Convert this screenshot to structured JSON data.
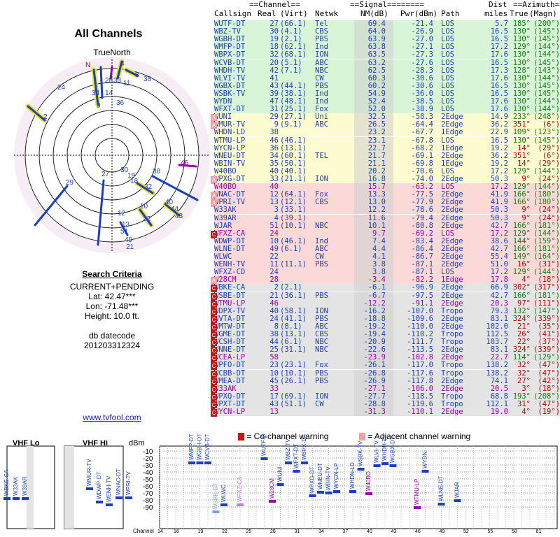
{
  "title": "All Channels",
  "north_label": "TrueNorth",
  "criteria": {
    "heading": "Search Criteria",
    "lines": [
      "CURRENT+PENDING",
      "Lat: 42.47***",
      "Lon: -71.48***",
      "Height: 10.0 ft.",
      "",
      "db datecode",
      "201203312324"
    ]
  },
  "site_link": "www.tvfool.com",
  "table_header": {
    "group_channel": "==Channel==",
    "group_signal": "==Signal========",
    "group_azimuth": "==Azimuth==",
    "cols": [
      "Callsign",
      "Real",
      "(Virt)",
      "Netwk",
      "NM(dB)",
      "Pwr(dBm)",
      "Path",
      "Dist",
      "True",
      "(Magn)"
    ],
    "dist_unit": "miles"
  },
  "colors": {
    "green": "#d8f5d8",
    "yellow": "#fdfbd0",
    "red": "#fbd9d9",
    "gray": "#e4e4e4",
    "nm_band": "#cfcfcf",
    "blue_text": "#1a3fc0",
    "purple_text": "#9b00b0",
    "red_text": "#c00000",
    "green_text": "#108010",
    "marker": "#c01818"
  },
  "stations": [
    [
      "WUTF-DT",
      "27",
      "(66.1)",
      "Tel",
      "69.4",
      "-21.4",
      "LOS",
      "5.7",
      "185°",
      "(200°)",
      "green",
      ""
    ],
    [
      "WBZ-TV",
      "30",
      "(4.1)",
      "CBS",
      "64.0",
      "-26.9",
      "LOS",
      "16.5",
      "130°",
      "(145°)",
      "green",
      ""
    ],
    [
      "WGBH-DT",
      "19",
      "(2.1)",
      "PBS",
      "63.9",
      "-27.0",
      "LOS",
      "16.5",
      "130°",
      "(145°)",
      "green",
      ""
    ],
    [
      "WMFP-DT",
      "18",
      "(62.1)",
      "Ind",
      "63.8",
      "-27.1",
      "LOS",
      "17.2",
      "129°",
      "(144°)",
      "green",
      ""
    ],
    [
      "WBPX-DT",
      "32",
      "(68.1)",
      "ION",
      "63.5",
      "-27.3",
      "LOS",
      "17.6",
      "130°",
      "(144°)",
      "green",
      ""
    ],
    [
      "WCVB-DT",
      "20",
      "(5.1)",
      "ABC",
      "63.2",
      "-27.6",
      "LOS",
      "16.5",
      "130°",
      "(145°)",
      "green",
      ""
    ],
    [
      "WHDH-TV",
      "42",
      "(7.1)",
      "NBC",
      "62.5",
      "-28.3",
      "LOS",
      "17.3",
      "128°",
      "(143°)",
      "green",
      ""
    ],
    [
      "WLVI-TV",
      "41",
      "",
      "CW",
      "60.3",
      "-30.6",
      "LOS",
      "17.6",
      "130°",
      "(144°)",
      "green",
      ""
    ],
    [
      "WGBX-DT",
      "43",
      "(44.1)",
      "PBS",
      "60.2",
      "-30.6",
      "LOS",
      "16.5",
      "130°",
      "(145°)",
      "green",
      ""
    ],
    [
      "WSBK-TV",
      "39",
      "(38.1)",
      "Ind",
      "54.9",
      "-36.0",
      "LOS",
      "16.5",
      "130°",
      "(145°)",
      "green",
      ""
    ],
    [
      "WYDN",
      "47",
      "(48.1)",
      "Ind",
      "52.4",
      "-38.5",
      "LOS",
      "17.6",
      "130°",
      "(144°)",
      "green",
      ""
    ],
    [
      "WFXT-DT",
      "31",
      "(25.1)",
      "Fox",
      "52.0",
      "-38.9",
      "LOS",
      "17.6",
      "130°",
      "(144°)",
      "green",
      ""
    ],
    [
      "WUNI",
      "29",
      "(27.1)",
      "Uni",
      "32.5",
      "-58.3",
      "2Edge",
      "14.9",
      "233°",
      "(248°)",
      "yellow",
      "A"
    ],
    [
      "WMUR-TV",
      "9",
      "(9.1)",
      "ABC",
      "26.5",
      "-64.4",
      "2Edge",
      "36.2",
      "351°",
      "(6°)",
      "yellow",
      "A"
    ],
    [
      "WHDN-LD",
      "38",
      "",
      "",
      "23.2",
      "-67.7",
      "1Edge",
      "22.9",
      "109°",
      "(123°)",
      "yellow",
      ""
    ],
    [
      "WTMU-LP",
      "46",
      "(46.1)",
      "",
      "23.1",
      "-67.8",
      "LOS",
      "16.5",
      "130°",
      "(145°)",
      "yellow",
      ""
    ],
    [
      "WYCN-LP",
      "36",
      "(13.1)",
      "",
      "22.7",
      "-68.2",
      "1Edge",
      "19.2",
      "14°",
      "(29°)",
      "yellow",
      ""
    ],
    [
      "WNEU-DT",
      "34",
      "(60.1)",
      "TEL",
      "21.7",
      "-69.1",
      "2Edge",
      "36.2",
      "351°",
      "(6°)",
      "yellow",
      ""
    ],
    [
      "WBIN-TV",
      "35",
      "(50.1)",
      "",
      "21.1",
      "-69.8",
      "1Edge",
      "19.2",
      "14°",
      "(29°)",
      "yellow",
      ""
    ],
    [
      "W40BO",
      "40",
      "(40.1)",
      "",
      "20.2",
      "-70.6",
      "LOS",
      "17.2",
      "129°",
      "(144°)",
      "yellow",
      ""
    ],
    [
      "WPXG-DT",
      "33",
      "(21.1)",
      "ION",
      "16.8",
      "-74.0",
      "2Edge",
      "50.3",
      "9°",
      "(24°)",
      "yellow",
      "A"
    ],
    [
      "W40BO",
      "40",
      "",
      "",
      "15.7",
      "-63.2",
      "LOS",
      "17.2",
      "129°",
      "(144°)",
      "red",
      ""
    ],
    [
      "WNAC-DT",
      "12",
      "(64.1)",
      "Fox",
      "13.3",
      "-77.5",
      "2Edge",
      "41.9",
      "166°",
      "(180°)",
      "red",
      "A"
    ],
    [
      "WPRI-TV",
      "13",
      "(12.1)",
      "CBS",
      "13.0",
      "-77.9",
      "2Edge",
      "41.9",
      "166°",
      "(180°)",
      "red",
      "A"
    ],
    [
      "W33AK",
      "3",
      "(33.1)",
      "",
      "12.2",
      "-78.6",
      "2Edge",
      "50.3",
      "9°",
      "(24°)",
      "red",
      ""
    ],
    [
      "W39AR",
      "4",
      "(39.1)",
      "",
      "11.6",
      "-79.4",
      "2Edge",
      "50.3",
      "9°",
      "(24°)",
      "red",
      ""
    ],
    [
      "WJAR",
      "51",
      "(10.1)",
      "NBC",
      "10.1",
      "-80.8",
      "2Edge",
      "42.7",
      "166°",
      "(181°)",
      "red",
      ""
    ],
    [
      "WFXZ-CA",
      "24",
      "",
      "",
      "9.7",
      "-69.2",
      "LOS",
      "17.2",
      "129°",
      "(144°)",
      "red",
      "C"
    ],
    [
      "WDWP-DT",
      "10",
      "(46.1)",
      "Ind",
      "7.4",
      "-83.4",
      "2Edge",
      "38.6",
      "144°",
      "(159°)",
      "red",
      ""
    ],
    [
      "WLNE-DT",
      "49",
      "(6.1)",
      "ABC",
      "4.4",
      "-86.4",
      "2Edge",
      "42.7",
      "166°",
      "(181°)",
      "red",
      ""
    ],
    [
      "WLWC",
      "22",
      "",
      "CW",
      "4.1",
      "-86.7",
      "2Edge",
      "55.4",
      "149°",
      "(164°)",
      "red",
      ""
    ],
    [
      "WENH-TV",
      "11",
      "(11.1)",
      "PBS",
      "3.8",
      "-87.1",
      "2Edge",
      "51.0",
      "16°",
      "(31°)",
      "red",
      ""
    ],
    [
      "WFXZ-CD",
      "24",
      "",
      "",
      "3.8",
      "-87.1",
      "LOS",
      "17.2",
      "129°",
      "(144°)",
      "red",
      ""
    ],
    [
      "W28CM",
      "28",
      "",
      "",
      "-3.4",
      "-82.2",
      "1Edge",
      "17.8",
      "4°",
      "(18°)",
      "red",
      "A"
    ],
    [
      "WBKE-CA",
      "2",
      "(2.1)",
      "",
      "-6.1",
      "-96.9",
      "2Edge",
      "66.9",
      "302°",
      "(317°)",
      "gray",
      "C"
    ],
    [
      "WSBE-DT",
      "21",
      "(36.1)",
      "PBS",
      "-6.7",
      "-97.5",
      "2Edge",
      "42.7",
      "166°",
      "(181°)",
      "gray",
      "C"
    ],
    [
      "WTMU-LP",
      "46",
      "",
      "",
      "-12.2",
      "-91.1",
      "2Edge",
      "20.3",
      "97°",
      "(111°)",
      "gray",
      "C"
    ],
    [
      "WDPX-TV",
      "40",
      "(58.1)",
      "ION",
      "-16.2",
      "-107.0",
      "Tropo",
      "79.3",
      "132°",
      "(147°)",
      "gray",
      "C"
    ],
    [
      "WVTA-DT",
      "24",
      "(41.1)",
      "PBS",
      "-18.8",
      "-109.6",
      "2Edge",
      "83.1",
      "324°",
      "(339°)",
      "gray",
      "C"
    ],
    [
      "WMTW-DT",
      "8",
      "(8.1)",
      "ABC",
      "-19.2",
      "-110.0",
      "2Edge",
      "102.0",
      "21°",
      "(35°)",
      "gray",
      "C"
    ],
    [
      "WGME-DT",
      "38",
      "(13.1)",
      "CBS",
      "-19.4",
      "-110.2",
      "Tropo",
      "112.5",
      "26°",
      "(41°)",
      "gray",
      "C"
    ],
    [
      "WCSH-DT",
      "44",
      "(6.1)",
      "NBC",
      "-20.9",
      "-111.7",
      "Tropo",
      "103.7",
      "22°",
      "(37°)",
      "gray",
      "C"
    ],
    [
      "WNNE-DT",
      "25",
      "(31.1)",
      "NBC",
      "-22.6",
      "-113.5",
      "2Edge",
      "83.1",
      "324°",
      "(339°)",
      "gray",
      "C"
    ],
    [
      "WCEA-LP",
      "58",
      "",
      "",
      "-23.9",
      "-102.8",
      "2Edge",
      "22.7",
      "114°",
      "(129°)",
      "gray",
      "C"
    ],
    [
      "WPFO-DT",
      "23",
      "(23.1)",
      "Fox",
      "-26.1",
      "-117.0",
      "Tropo",
      "138.2",
      "32°",
      "(47°)",
      "gray",
      "C"
    ],
    [
      "WCBB-DT",
      "10",
      "(10.1)",
      "PBS",
      "-26.8",
      "-117.6",
      "Tropo",
      "138.2",
      "32°",
      "(47°)",
      "gray",
      "C"
    ],
    [
      "WMEA-DT",
      "45",
      "(26.1)",
      "PBS",
      "-26.9",
      "-117.8",
      "2Edge",
      "74.1",
      "27°",
      "(42°)",
      "gray",
      "C"
    ],
    [
      "W33AK",
      "33",
      "",
      "",
      "-27.1",
      "-106.0",
      "2Edge",
      "20.5",
      "3°",
      "(18°)",
      "gray",
      "C"
    ],
    [
      "WPXQ-DT",
      "17",
      "(69.1)",
      "ION",
      "-27.7",
      "-118.5",
      "Tropo",
      "68.8",
      "193°",
      "(208°)",
      "gray",
      "C"
    ],
    [
      "WPXT-DT",
      "43",
      "(51.1)",
      "CW",
      "-28.8",
      "-119.6",
      "Tropo",
      "112.1",
      "31°",
      "(47°)",
      "gray",
      "C"
    ],
    [
      "WYCN-LP",
      "13",
      "",
      "",
      "-31.3",
      "-110.1",
      "2Edge",
      "19.0",
      "4°",
      "(19°)",
      "gray",
      "C"
    ]
  ],
  "legend": {
    "cochannel": "= Co-channel warning",
    "adjacent": "= Adjacent channel warning"
  },
  "spectrum": {
    "vhf_lo": "VHF Lo",
    "vhf_hi": "VHF Hi",
    "dbm_label": "dBm",
    "channel_label": "Channel",
    "yticks": [
      "-10",
      "-20",
      "-30",
      "-40",
      "-50",
      "-60",
      "-70",
      "-80",
      "-90"
    ]
  },
  "polar_labels": [
    [
      "N",
      122,
      96,
      "#c00000"
    ],
    [
      "4",
      172,
      94,
      "#1a3fc0"
    ],
    [
      "24",
      82,
      128,
      "#1a3fc0"
    ],
    [
      "28",
      150,
      118,
      "#1a3fc0"
    ],
    [
      "33",
      162,
      118,
      "#1a3fc0"
    ],
    [
      "11",
      176,
      122,
      "#1a3fc0"
    ],
    [
      "8",
      193,
      110,
      "#1a3fc0"
    ],
    [
      "38",
      205,
      116,
      "#1a3fc0"
    ],
    [
      "34",
      131,
      136,
      "#1a3fc0"
    ],
    [
      "14",
      150,
      136,
      "#1a3fc0"
    ],
    [
      "9",
      138,
      154,
      "#1a3fc0"
    ],
    [
      "36",
      166,
      150,
      "#1a3fc0"
    ],
    [
      "2",
      62,
      170,
      "#1a3fc0"
    ],
    [
      "46",
      258,
      236,
      "#9b00b0"
    ],
    [
      "27",
      145,
      252,
      "#1a3fc0"
    ],
    [
      "30",
      172,
      246,
      "#1a3fc0"
    ],
    [
      "19",
      182,
      254,
      "#1a3fc0"
    ],
    [
      "18",
      186,
      262,
      "#1a3fc0"
    ],
    [
      "38",
      218,
      248,
      "#1a3fc0"
    ],
    [
      "29",
      94,
      264,
      "#1a3fc0"
    ],
    [
      "32",
      206,
      270,
      "#1a3fc0"
    ],
    [
      "40",
      236,
      292,
      "#1a3fc0"
    ],
    [
      "44",
      244,
      302,
      "#1a3fc0"
    ],
    [
      "43",
      250,
      312,
      "#1a3fc0"
    ],
    [
      "10",
      200,
      298,
      "#1a3fc0"
    ],
    [
      "12",
      168,
      308,
      "#1a3fc0"
    ],
    [
      "22",
      204,
      316,
      "#1a3fc0"
    ],
    [
      "13",
      174,
      324,
      "#1a3fc0"
    ],
    [
      "51",
      172,
      334,
      "#1a3fc0"
    ],
    [
      "49",
      178,
      346,
      "#1a3fc0"
    ],
    [
      "21",
      180,
      356,
      "#1a3fc0"
    ]
  ],
  "spectrum_stations": [
    [
      "WBKE-CA",
      2,
      -78,
      "#1a3fc0"
    ],
    [
      "W33AK",
      3,
      -78,
      "#1a3fc0"
    ],
    [
      "W39AR",
      4,
      -78,
      "#1a3fc0"
    ],
    [
      "WMUR-TV",
      9,
      -64,
      "#1a3fc0"
    ],
    [
      "WDWP-DT",
      10,
      -83,
      "#1a3fc0"
    ],
    [
      "WENH-TV",
      11,
      -87,
      "#1a3fc0"
    ],
    [
      "WNAC-DT",
      12,
      -77,
      "#1a3fc0"
    ],
    [
      "WPRI-TV",
      13,
      -77,
      "#1a3fc0"
    ],
    [
      "WMFP-DT",
      18,
      -27,
      "#1a3fc0"
    ],
    [
      "WGBH-DT",
      19,
      -27,
      "#1a3fc0"
    ],
    [
      "WCVB-DT",
      20,
      -27,
      "#1a3fc0"
    ],
    [
      "WSBE-DT",
      21,
      -97,
      "#7fa0e0"
    ],
    [
      "WLWC",
      22,
      -87,
      "#1a3fc0"
    ],
    [
      "WFXZ-CA",
      24,
      -87,
      "#c080e0"
    ],
    [
      "WUTF-DT",
      27,
      -21,
      "#1a3fc0"
    ],
    [
      "W28CM",
      28,
      -82,
      "#9b00b0"
    ],
    [
      "WUNI",
      29,
      -58,
      "#1a3fc0"
    ],
    [
      "WBZ-TV",
      30,
      -27,
      "#1a3fc0"
    ],
    [
      "WFXT-DT",
      31,
      -39,
      "#1a3fc0"
    ],
    [
      "WBPX-DT",
      32,
      -27,
      "#1a3fc0"
    ],
    [
      "WPXG-DT",
      33,
      -74,
      "#1a3fc0"
    ],
    [
      "WNEU-DT",
      34,
      -69,
      "#1a3fc0"
    ],
    [
      "WBIN-TV",
      35,
      -70,
      "#1a3fc0"
    ],
    [
      "WYCN-LP",
      36,
      -68,
      "#1a3fc0"
    ],
    [
      "WHDN-LD",
      38,
      -68,
      "#1a3fc0"
    ],
    [
      "WSBK-TV",
      39,
      -36,
      "#1a3fc0"
    ],
    [
      "W40BO",
      40,
      -71,
      "#9b00b0"
    ],
    [
      "WLVI-TV",
      41,
      -31,
      "#1a3fc0"
    ],
    [
      "WHDH-TV",
      42,
      -28,
      "#1a3fc0"
    ],
    [
      "WGBX-DT",
      43,
      -31,
      "#1a3fc0"
    ],
    [
      "WTMU-LP",
      46,
      -91,
      "#9b00b0"
    ],
    [
      "WYDN",
      47,
      -39,
      "#1a3fc0"
    ],
    [
      "WLNE-DT",
      49,
      -86,
      "#1a3fc0"
    ],
    [
      "WJAR",
      51,
      -81,
      "#1a3fc0"
    ]
  ]
}
